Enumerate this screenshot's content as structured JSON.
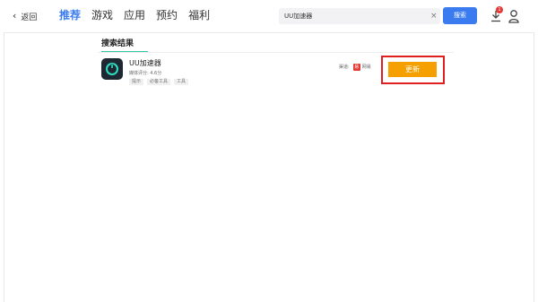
{
  "header": {
    "back_label": "返回",
    "nav": [
      {
        "label": "推荐",
        "active": true
      },
      {
        "label": "游戏",
        "active": false
      },
      {
        "label": "应用",
        "active": false
      },
      {
        "label": "预约",
        "active": false
      },
      {
        "label": "福利",
        "active": false
      }
    ],
    "search": {
      "value": "UU加速器",
      "button_label": "搜索"
    },
    "download_badge": "1"
  },
  "results": {
    "title": "搜索结果",
    "apps": [
      {
        "name": "UU加速器",
        "rating": "媒体评分: 4.6分",
        "tags": [
          "提示",
          "必备工具",
          "工具"
        ],
        "channel_label": "渠道:",
        "channel_name": "网易",
        "channel_icon_text": "易",
        "action_label": "更新"
      }
    ]
  },
  "colors": {
    "accent": "#3a7cf0",
    "update_button": "#f5a000",
    "highlight": "#e02020",
    "section_underline": "#2ec4a6"
  }
}
